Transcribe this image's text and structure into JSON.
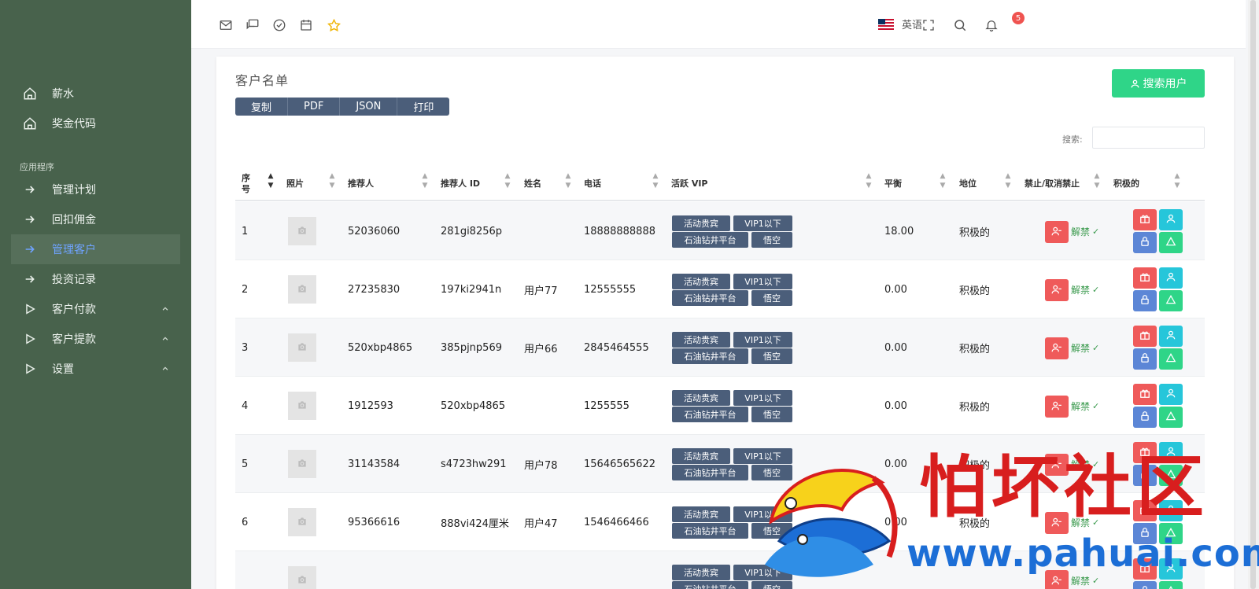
{
  "sidebar": {
    "items_top": [
      {
        "label": "薪水",
        "icon": "home-icon"
      },
      {
        "label": "奖金代码",
        "icon": "home-icon"
      }
    ],
    "section_label": "应用程序",
    "items": [
      {
        "label": "管理计划",
        "icon": "arrow-right-icon",
        "active": false
      },
      {
        "label": "回扣佣金",
        "icon": "arrow-right-icon",
        "active": false
      },
      {
        "label": "管理客户",
        "icon": "arrow-right-icon",
        "active": true
      },
      {
        "label": "投资记录",
        "icon": "arrow-right-icon",
        "active": false
      },
      {
        "label": "客户付款",
        "icon": "play-icon",
        "expandable": true
      },
      {
        "label": "客户提款",
        "icon": "play-icon",
        "expandable": true
      },
      {
        "label": "设置",
        "icon": "play-icon",
        "expandable": true
      }
    ]
  },
  "topbar": {
    "language": "英语",
    "notification_count": "5"
  },
  "card": {
    "title": "客户名单",
    "export_buttons": [
      "复制",
      "PDF",
      "JSON",
      "打印"
    ],
    "search_user_label": "搜索用户",
    "search_label": "搜索:"
  },
  "table": {
    "headers": [
      "序号",
      "照片",
      "推荐人",
      "推荐人 ID",
      "姓名",
      "电话",
      "活跃 VIP",
      "平衡",
      "地位",
      "禁止/取消禁止",
      "积极的"
    ],
    "tags": [
      "活动贵宾",
      "VIP1以下",
      "石油钻井平台",
      "悟空"
    ],
    "unban_label": "解禁",
    "rows": [
      {
        "no": "1",
        "referrer": "52036060",
        "referrer_id": "281gi8256p",
        "name": "",
        "phone": "18888888888",
        "balance": "18.00",
        "status": "积极的"
      },
      {
        "no": "2",
        "referrer": "27235830",
        "referrer_id": "197ki2941n",
        "name": "用户77",
        "phone": "12555555",
        "balance": "0.00",
        "status": "积极的"
      },
      {
        "no": "3",
        "referrer": "520xbp4865",
        "referrer_id": "385pjnp569",
        "name": "用户66",
        "phone": "2845464555",
        "balance": "0.00",
        "status": "积极的"
      },
      {
        "no": "4",
        "referrer": "1912593",
        "referrer_id": "520xbp4865",
        "name": "",
        "phone": "1255555",
        "balance": "0.00",
        "status": "积极的"
      },
      {
        "no": "5",
        "referrer": "31143584",
        "referrer_id": "s4723hw291",
        "name": "用户78",
        "phone": "15646565622",
        "balance": "0.00",
        "status": "积极的"
      },
      {
        "no": "6",
        "referrer": "95366616",
        "referrer_id": "888vi424厘米",
        "name": "用户47",
        "phone": "1546466466",
        "balance": "0.00",
        "status": "积极的"
      },
      {
        "no": "",
        "referrer": "",
        "referrer_id": "",
        "name": "",
        "phone": "",
        "balance": "",
        "status": ""
      }
    ]
  },
  "watermark": {
    "text": "怕坏社区",
    "url": "www.pahuai.com"
  }
}
